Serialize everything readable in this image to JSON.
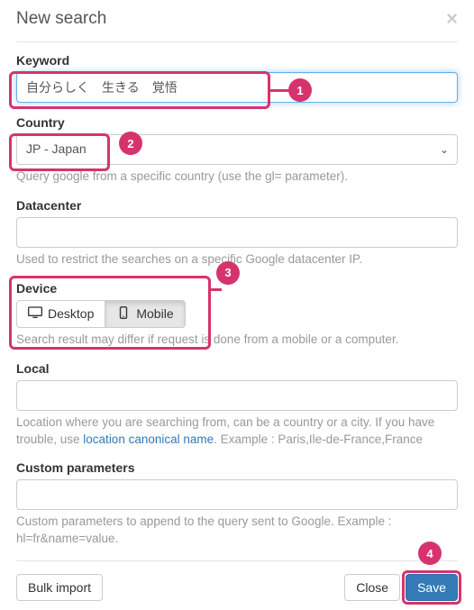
{
  "modal": {
    "title": "New search",
    "close_glyph": "×"
  },
  "keyword": {
    "label": "Keyword",
    "value": "自分らしく　生きる　覚悟"
  },
  "country": {
    "label": "Country",
    "value": "JP - Japan",
    "help": "Query google from a specific country (use the gl= parameter)."
  },
  "datacenter": {
    "label": "Datacenter",
    "value": "",
    "help": "Used to restrict the searches on a specific Google datacenter IP."
  },
  "device": {
    "label": "Device",
    "desktop": "Desktop",
    "mobile": "Mobile",
    "help": "Search result may differ if request is done from a mobile or a computer."
  },
  "local": {
    "label": "Local",
    "value": "",
    "help_pre": "Location where you are searching from, can be a country or a city. If you have trouble, use ",
    "help_link": "location canonical name",
    "help_post": ". Example : Paris,Ile-de-France,France"
  },
  "custom": {
    "label": "Custom parameters",
    "value": "",
    "help": "Custom parameters to append to the query sent to Google. Example : hl=fr&name=value."
  },
  "footer": {
    "bulk": "Bulk import",
    "close": "Close",
    "save": "Save"
  },
  "annotations": {
    "b1": "1",
    "b2": "2",
    "b3": "3",
    "b4": "4"
  }
}
